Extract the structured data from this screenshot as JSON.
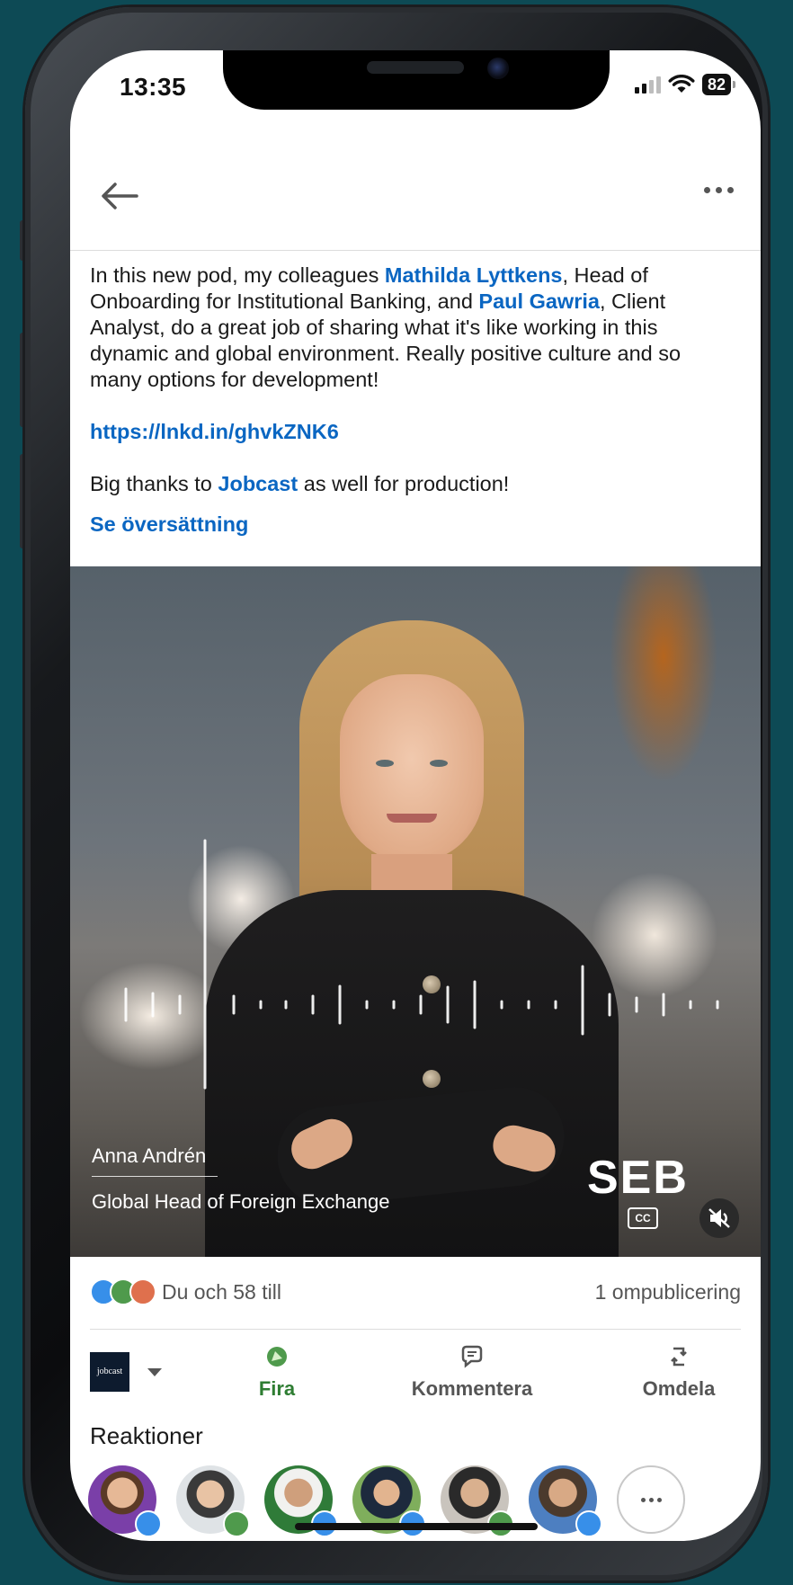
{
  "status_bar": {
    "time": "13:35",
    "battery": "82"
  },
  "post": {
    "text_1": "In this new pod, my colleagues ",
    "mention_1": "Mathilda Lyttkens",
    "text_2": ", Head of Onboarding for Institutional Banking, and ",
    "mention_2": "Paul Gawria",
    "text_3": ", Client Analyst, do a great job of sharing what it's like working in this dynamic and global environment. Really positive culture and so many options for development!",
    "url": "https://lnkd.in/ghvkZNK6",
    "thanks_1": "Big thanks to ",
    "mention_3": "Jobcast",
    "thanks_2": " as well for production!",
    "translate_label": "Se översättning"
  },
  "video": {
    "person_name": "Anna Andrén",
    "person_title": "Global Head of Foreign Exchange",
    "brand_logo": "SEB",
    "cc_label": "CC"
  },
  "social": {
    "reactions_summary": "Du och 58 till",
    "reposts": "1 ompublicering"
  },
  "actions": {
    "brand_avatar": "jobcast",
    "celebrate": "Fira",
    "comment": "Kommentera",
    "share": "Omdela"
  },
  "reactions": {
    "title": "Reaktioner",
    "avatars": [
      {
        "badge": "like"
      },
      {
        "badge": "celebrate"
      },
      {
        "badge": "like"
      },
      {
        "badge": "like"
      },
      {
        "badge": "celebrate"
      },
      {
        "badge": "like"
      }
    ]
  },
  "colors": {
    "link": "#0a66c2",
    "celebrate": "#2e7d32",
    "background": "#0d4a55"
  }
}
